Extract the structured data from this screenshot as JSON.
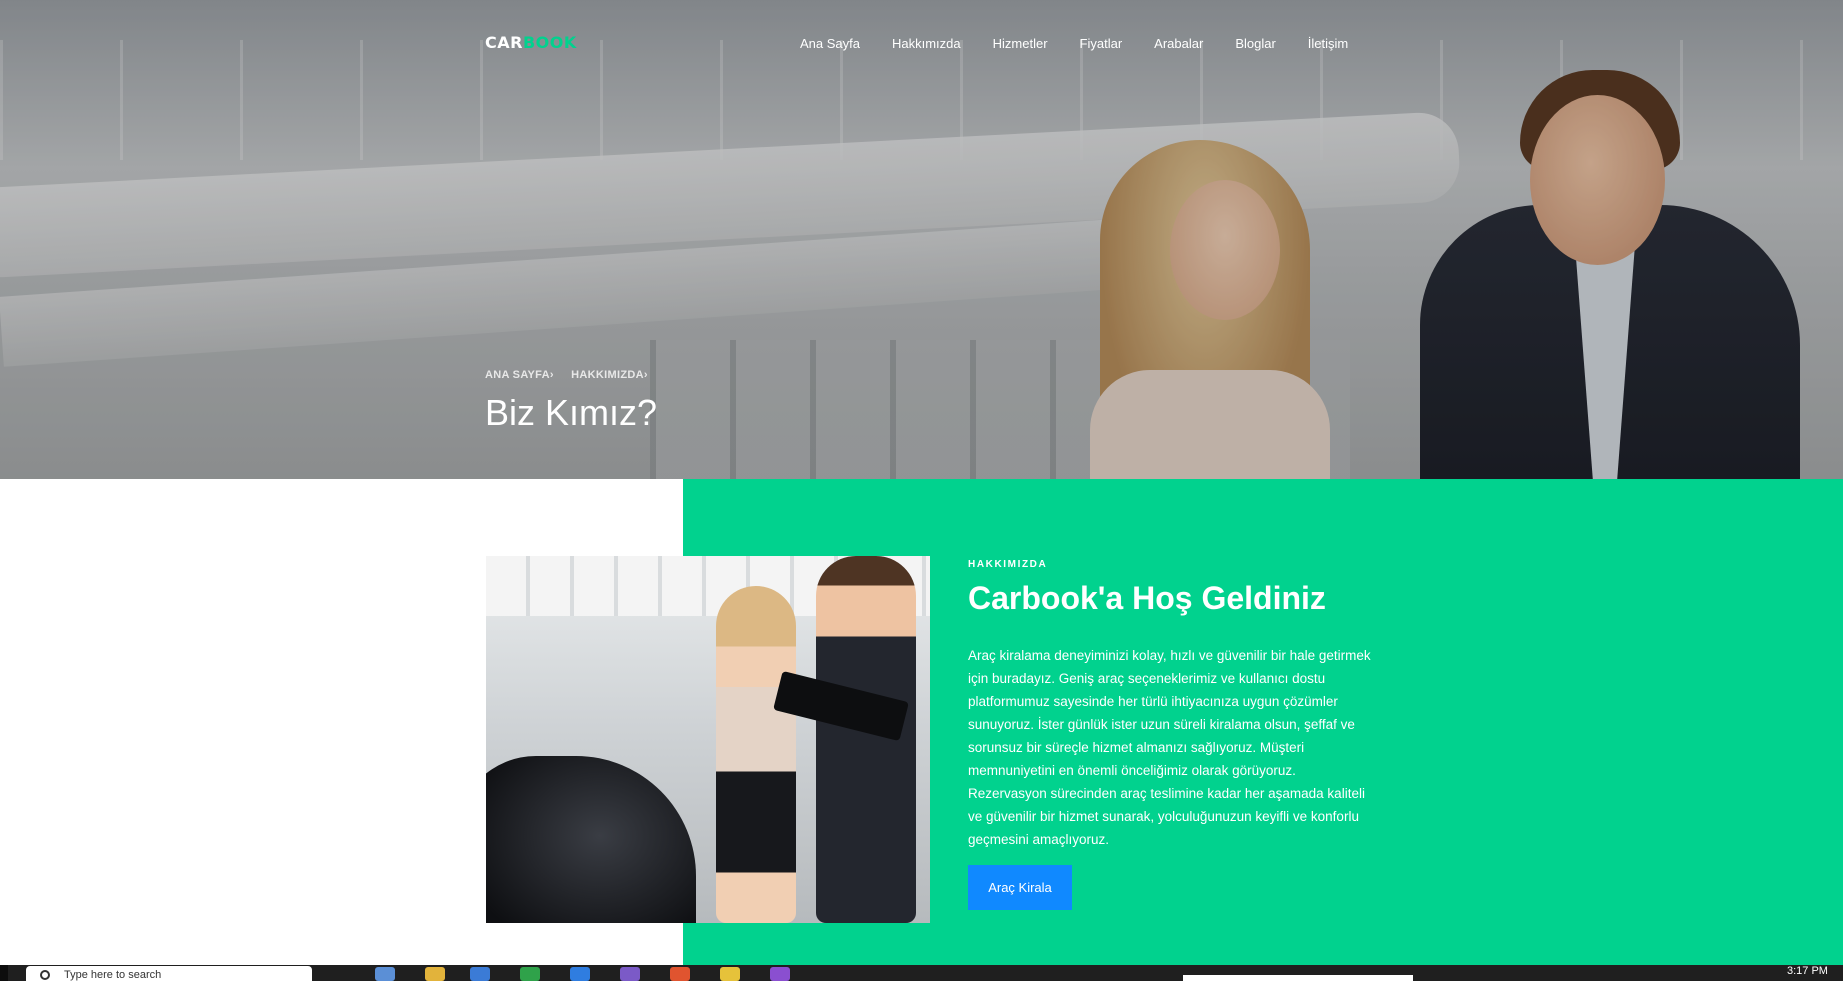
{
  "nav": {
    "logo_part1": "CAR",
    "logo_part2": "BOOK",
    "items": [
      "Ana Sayfa",
      "Hakkımızda",
      "Hizmetler",
      "Fiyatlar",
      "Arabalar",
      "Bloglar",
      "İletişim"
    ]
  },
  "hero": {
    "breadcrumb": [
      "ANA SAYFA",
      "HAKKIMIZDA"
    ],
    "title": "Biz Kımız?"
  },
  "about": {
    "label": "HAKKIMIZDA",
    "title": "Carbook'a Hoş Geldiniz",
    "text": "Araç kiralama deneyiminizi kolay, hızlı ve güvenilir bir hale getirmek için buradayız. Geniş araç seçeneklerimiz ve kullanıcı dostu platformumuz sayesinde her türlü ihtiyacınıza uygun çözümler sunuyoruz. İster günlük ister uzun süreli kiralama olsun, şeffaf ve sorunsuz bir süreçle hizmet almanızı sağlıyoruz. Müşteri memnuniyetini en önemli önceliğimiz olarak görüyoruz. Rezervasyon sürecinden araç teslimine kadar her aşamada kaliteli ve güvenilir bir hizmet sunarak, yolculuğunuzun keyifli ve konforlu geçmesini amaçlıyoruz.",
    "button": "Araç Kirala"
  },
  "taskbar": {
    "search_placeholder": "Type here to search",
    "time": "3:17 PM"
  },
  "colors": {
    "accent_green": "#01d28e",
    "button_blue": "#1089ff"
  }
}
